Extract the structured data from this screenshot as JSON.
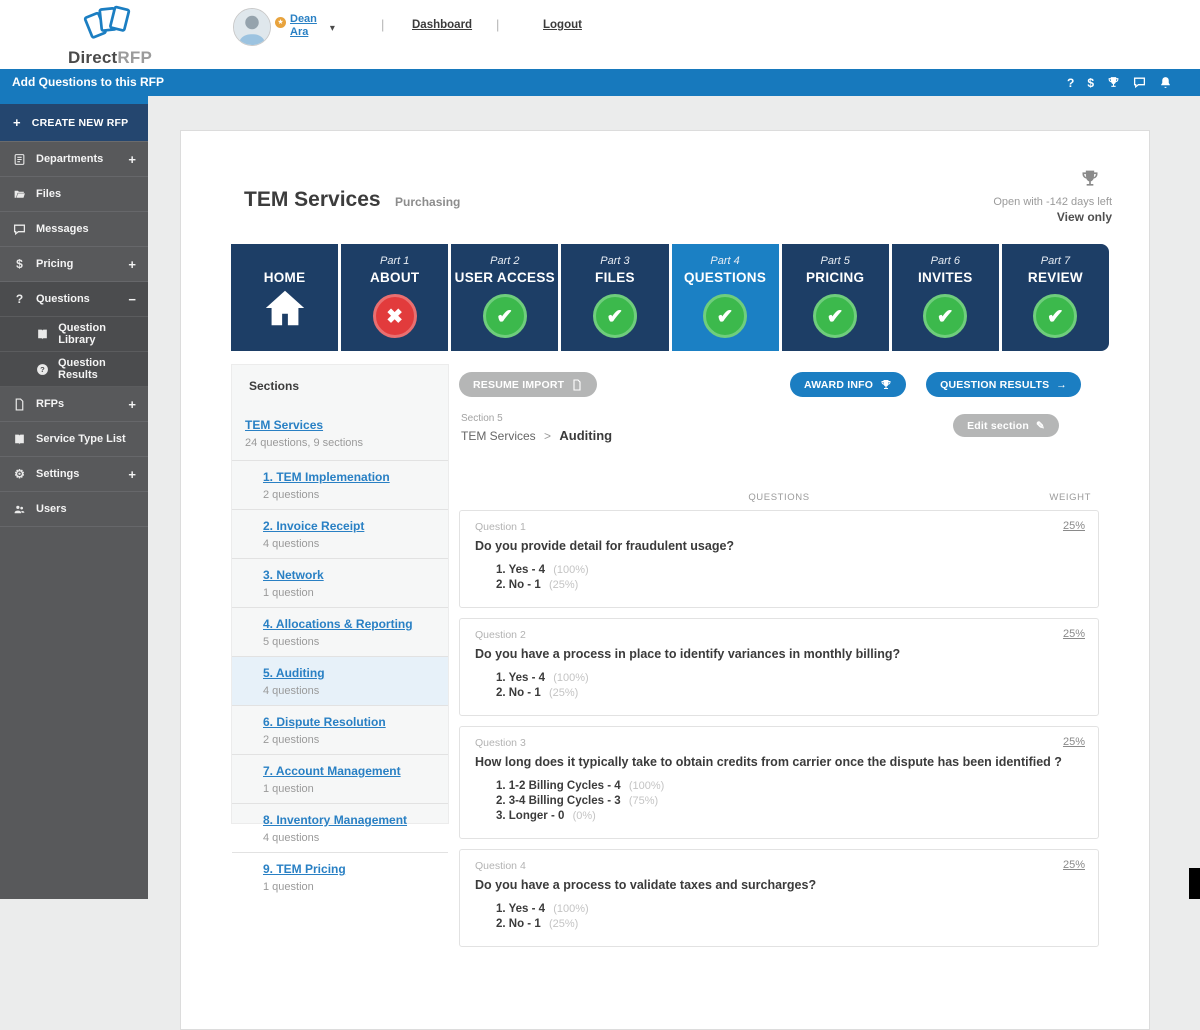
{
  "colors": {
    "action_bar_blue": "#1779bd",
    "tab_navy": "#1d3e66",
    "tab_active_blue": "#1b80c4",
    "pass_green": "#3cb94c",
    "fail_red": "#e23b3c",
    "sidebar_gray": "#58595b",
    "create_navy": "#24466f",
    "link_blue": "#2980c4"
  },
  "header": {
    "brand": {
      "direct": "Direct",
      "rfp": "RFP"
    },
    "user": {
      "first": "Dean",
      "last": "Ara",
      "badge_icon": "star-badge-icon",
      "avatar_icon": "person-avatar"
    },
    "sep": "|",
    "nav": {
      "dashboard": "Dashboard",
      "logout": "Logout"
    }
  },
  "action_bar": {
    "title": "Add Questions to this RFP",
    "icons": [
      "help-icon",
      "dollar-icon",
      "trophy-icon",
      "chat-icon",
      "bell-icon"
    ]
  },
  "sidebar": {
    "create_label": "CREATE NEW RFP",
    "create_icon": "plus-icon",
    "items": [
      {
        "name": "departments",
        "icon": "departments-icon",
        "label": "Departments",
        "expand": "+"
      },
      {
        "name": "files",
        "icon": "folder-icon",
        "label": "Files"
      },
      {
        "name": "messages",
        "icon": "chat-icon",
        "label": "Messages"
      },
      {
        "name": "pricing",
        "icon": "dollar-icon",
        "label": "Pricing",
        "expand": "+"
      },
      {
        "name": "questions",
        "icon": "question-icon",
        "label": "Questions",
        "expand": "−",
        "group": true
      },
      {
        "name": "question-library",
        "icon": "book-icon",
        "label": "Question Library",
        "sub": true,
        "group": true
      },
      {
        "name": "question-results",
        "icon": "question-circle-icon",
        "label": "Question Results",
        "sub": true,
        "group": true
      },
      {
        "name": "rfps",
        "icon": "doc-icon",
        "label": "RFPs",
        "expand": "+"
      },
      {
        "name": "service-type-list",
        "icon": "book-icon",
        "label": "Service Type List"
      },
      {
        "name": "settings",
        "icon": "gear-icon",
        "label": "Settings",
        "expand": "+"
      },
      {
        "name": "users",
        "icon": "users-icon",
        "label": "Users"
      }
    ]
  },
  "main": {
    "title": "TEM Services",
    "subtitle": "Purchasing",
    "status": {
      "icon": "trophy-icon",
      "open_text": "Open with -142 days left",
      "view_text": "View only"
    },
    "tabs": [
      {
        "name": "home",
        "part": "",
        "label": "HOME",
        "state": "home"
      },
      {
        "name": "about",
        "part": "Part 1",
        "label": "ABOUT",
        "state": "fail"
      },
      {
        "name": "user-access",
        "part": "Part 2",
        "label": "USER ACCESS",
        "state": "pass"
      },
      {
        "name": "files",
        "part": "Part 3",
        "label": "FILES",
        "state": "pass"
      },
      {
        "name": "questions",
        "part": "Part 4",
        "label": "QUESTIONS",
        "state": "pass",
        "active": true
      },
      {
        "name": "pricing",
        "part": "Part 5",
        "label": "PRICING",
        "state": "pass"
      },
      {
        "name": "invites",
        "part": "Part 6",
        "label": "INVITES",
        "state": "pass"
      },
      {
        "name": "review",
        "part": "Part 7",
        "label": "REVIEW",
        "state": "pass"
      }
    ],
    "sections_panel": {
      "heading": "Sections",
      "root": {
        "label": "TEM Services",
        "meta": "24 questions, 9 sections"
      },
      "items": [
        {
          "name": "tem-implemenation",
          "label": "1. TEM Implemenation",
          "meta": "2 questions"
        },
        {
          "name": "invoice-receipt",
          "label": "2. Invoice Receipt",
          "meta": "4 questions"
        },
        {
          "name": "network",
          "label": "3. Network",
          "meta": "1 question"
        },
        {
          "name": "allocations-reporting",
          "label": "4. Allocations & Reporting",
          "meta": "5 questions"
        },
        {
          "name": "auditing",
          "label": "5. Auditing",
          "meta": "4 questions",
          "active": true
        },
        {
          "name": "dispute-resolution",
          "label": "6. Dispute Resolution",
          "meta": "2 questions"
        },
        {
          "name": "account-management",
          "label": "7. Account Management",
          "meta": "1 question"
        },
        {
          "name": "inventory-management",
          "label": "8. Inventory Management",
          "meta": "4 questions"
        },
        {
          "name": "tem-pricing",
          "label": "9. TEM Pricing",
          "meta": "1 question"
        }
      ]
    },
    "content": {
      "buttons": {
        "resume_import": "RESUME IMPORT",
        "award_info": "AWARD INFO",
        "question_results": "QUESTION RESULTS",
        "edit_section": "Edit section"
      },
      "section_label": "Section 5",
      "breadcrumb": {
        "root": "TEM Services",
        "sep": ">",
        "current": "Auditing"
      },
      "table_headers": {
        "questions": "QUESTIONS",
        "weight": "WEIGHT"
      },
      "questions": [
        {
          "name": "1",
          "number": "Question 1",
          "weight": "25%",
          "text": "Do you provide detail for fraudulent usage?",
          "answers": [
            {
              "label": "1. Yes - 4",
              "pct": "(100%)"
            },
            {
              "label": "2. No - 1",
              "pct": "(25%)"
            }
          ]
        },
        {
          "name": "2",
          "number": "Question 2",
          "weight": "25%",
          "text": "Do you have a process in place to identify variances in monthly billing?",
          "answers": [
            {
              "label": "1. Yes - 4",
              "pct": "(100%)"
            },
            {
              "label": "2. No - 1",
              "pct": "(25%)"
            }
          ]
        },
        {
          "name": "3",
          "number": "Question 3",
          "weight": "25%",
          "text": "How long does it typically take to obtain credits from carrier once the dispute has been identified ?",
          "answers": [
            {
              "label": "1. 1-2 Billing Cycles - 4",
              "pct": "(100%)"
            },
            {
              "label": "2. 3-4 Billing Cycles - 3",
              "pct": "(75%)"
            },
            {
              "label": "3. Longer - 0",
              "pct": "(0%)"
            }
          ]
        },
        {
          "name": "4",
          "number": "Question 4",
          "weight": "25%",
          "text": "Do you have a process to validate taxes and surcharges?",
          "answers": [
            {
              "label": "1. Yes - 4",
              "pct": "(100%)"
            },
            {
              "label": "2. No - 1",
              "pct": "(25%)"
            }
          ]
        }
      ]
    }
  }
}
